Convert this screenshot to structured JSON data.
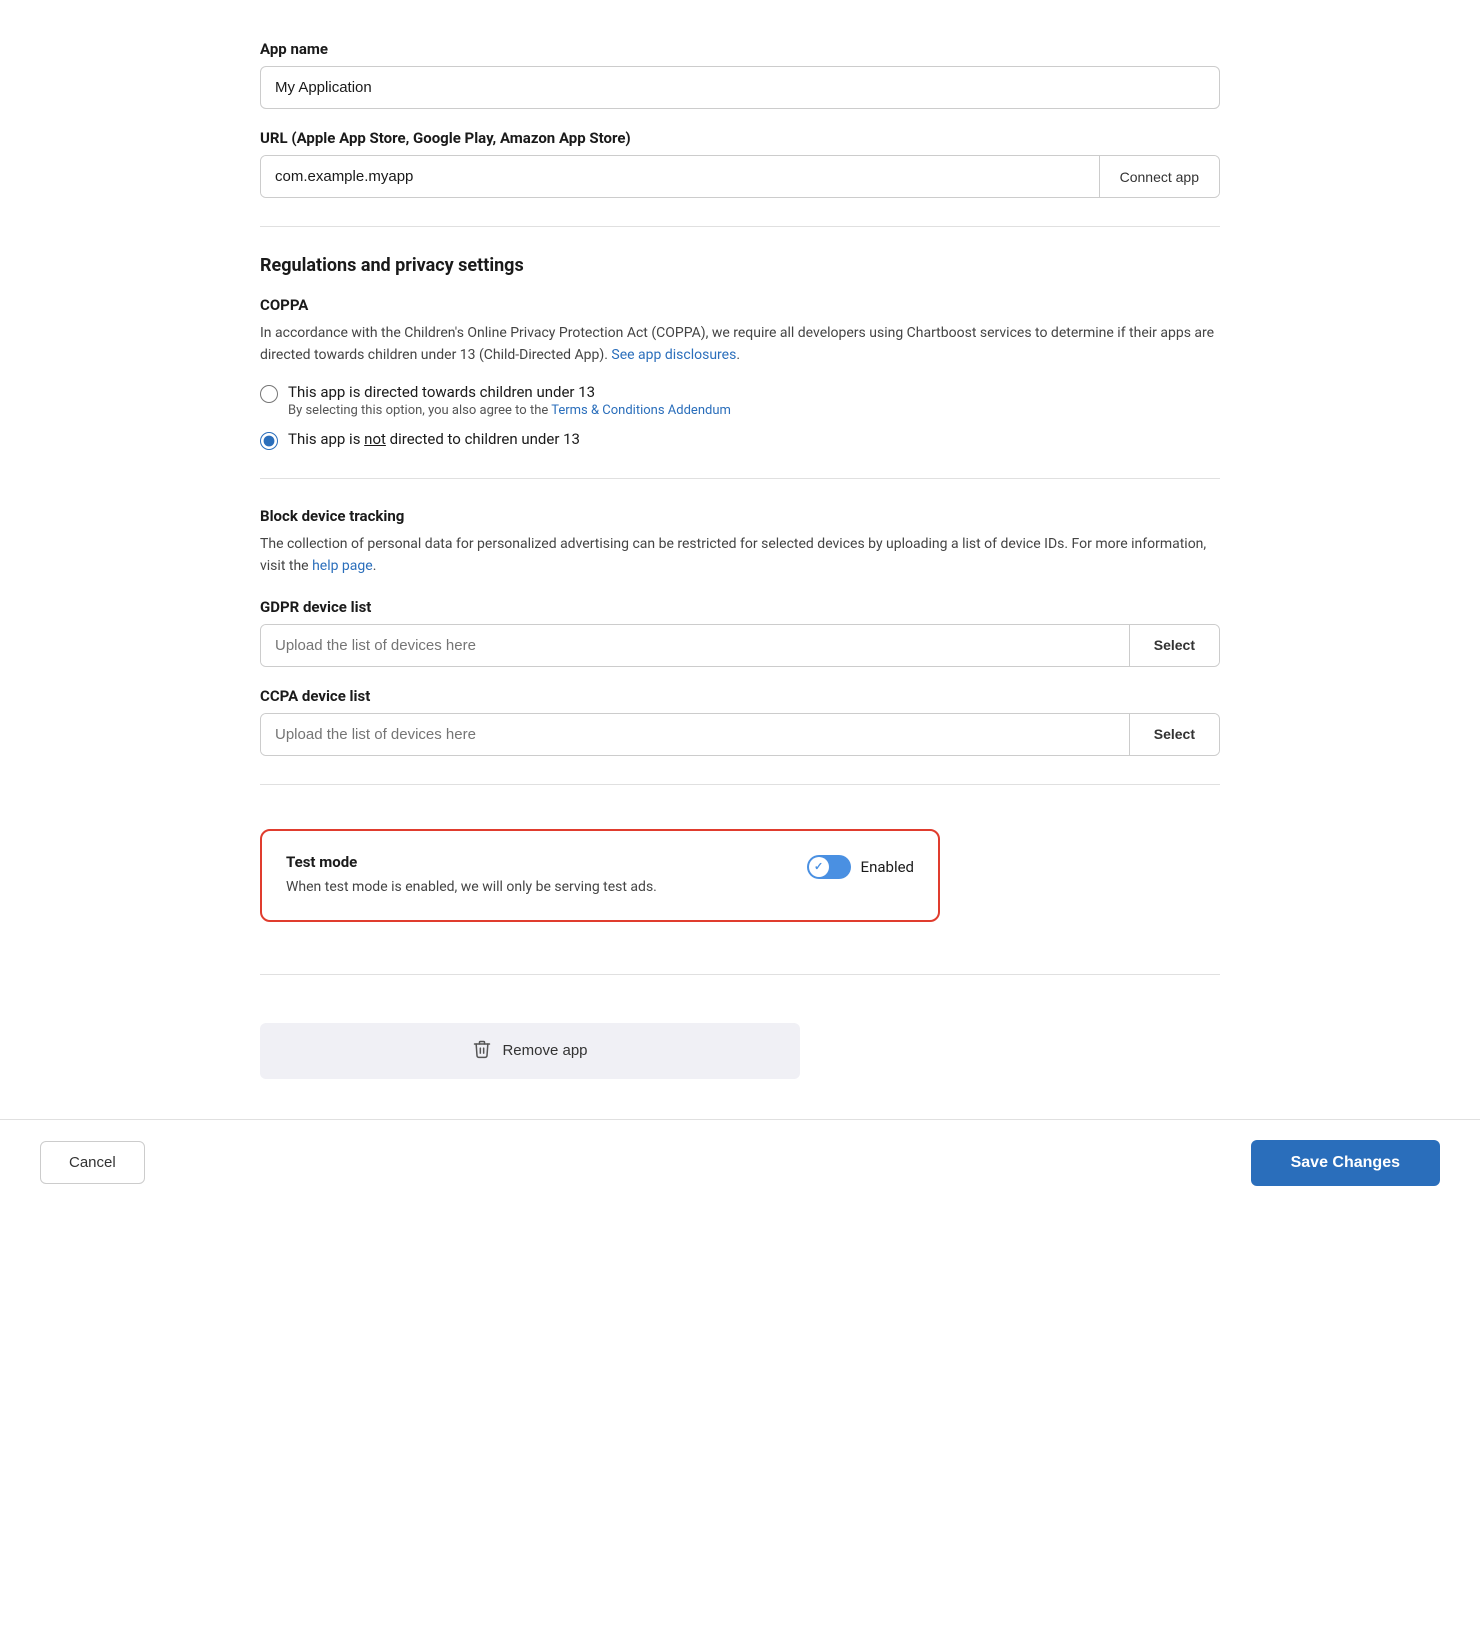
{
  "app_name": {
    "label": "App name",
    "value": "My Application",
    "placeholder": "My Application"
  },
  "url_field": {
    "label": "URL (Apple App Store, Google Play, Amazon App Store)",
    "value": "com.example.myapp",
    "placeholder": "com.example.myapp",
    "connect_btn_label": "Connect app"
  },
  "regulations": {
    "section_title": "Regulations and privacy settings",
    "coppa": {
      "title": "COPPA",
      "description_part1": "In accordance with the Children's Online Privacy Protection Act (COPPA), we require all developers using Chartboost services to determine if their apps are directed towards children under 13 (Child-Directed App). ",
      "description_link": "See app disclosures",
      "description_end": ".",
      "radio_option1_label": "This app is directed towards children under 13",
      "radio_option1_sublabel_part1": "By selecting this option, you also agree to the ",
      "radio_option1_sublabel_link": "Terms & Conditions Addendum",
      "radio_option2_label_pre": "This app is ",
      "radio_option2_label_underline": "not",
      "radio_option2_label_post": " directed to children under 13"
    },
    "block_tracking": {
      "title": "Block device tracking",
      "description_part1": "The collection of personal data for personalized advertising can be restricted for selected devices by uploading a list of device IDs. For more information, visit the ",
      "description_link": "help page",
      "description_end": "."
    },
    "gdpr": {
      "label": "GDPR device list",
      "placeholder": "Upload the list of devices here",
      "select_btn_label": "Select"
    },
    "ccpa": {
      "label": "CCPA device list",
      "placeholder": "Upload the list of devices here",
      "select_btn_label": "Select"
    }
  },
  "test_mode": {
    "title": "Test mode",
    "description": "When test mode is enabled, we will only be serving test ads.",
    "toggle_label": "Enabled",
    "is_enabled": true
  },
  "remove_app": {
    "label": "Remove app"
  },
  "footer": {
    "cancel_label": "Cancel",
    "save_label": "Save Changes"
  }
}
